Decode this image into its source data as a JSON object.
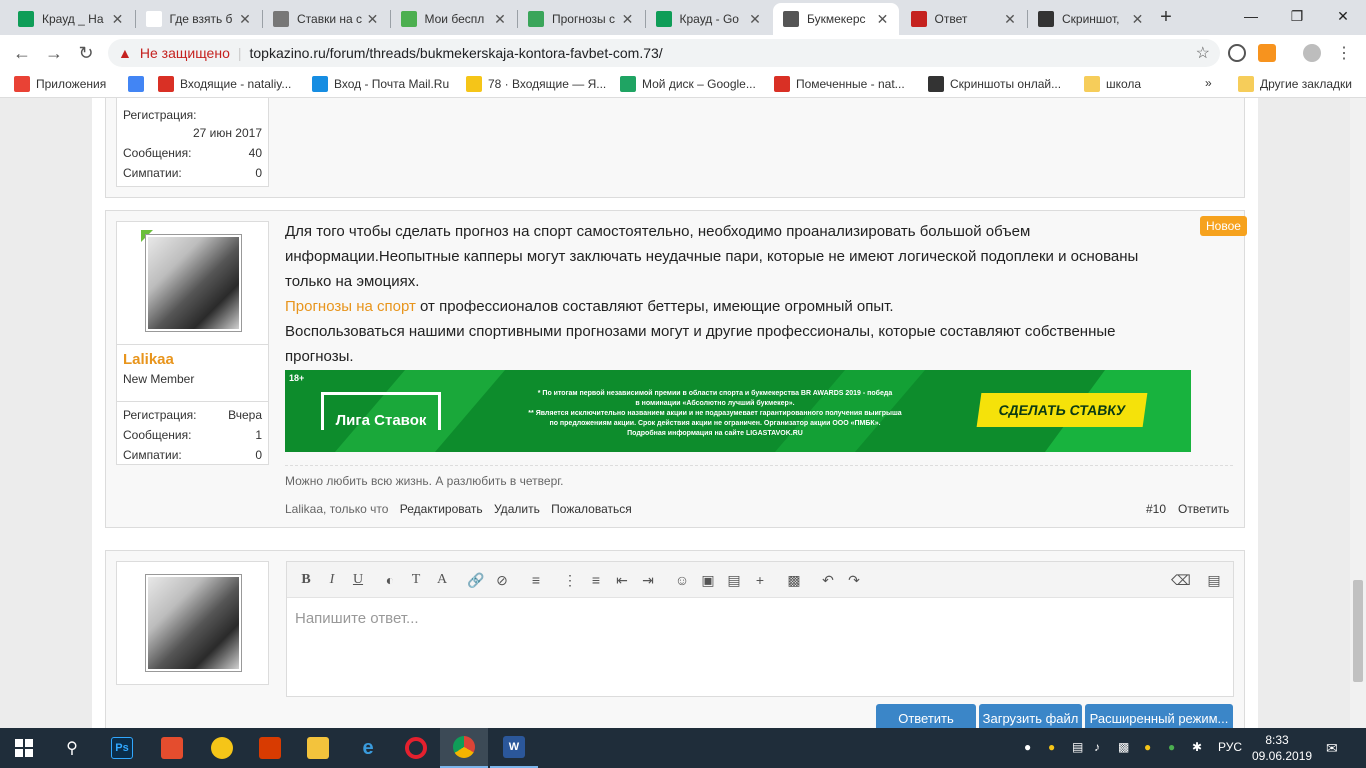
{
  "tabs": [
    {
      "label": "Крауд _ На",
      "icon": "sheets-icon",
      "color": "#0f9d58"
    },
    {
      "label": "Где взять б",
      "icon": "google-icon",
      "color": "#ffffff"
    },
    {
      "label": "Ставки на с",
      "icon": "globe-icon",
      "color": "#777777"
    },
    {
      "label": "Мои беспл",
      "icon": "gem-icon",
      "color": "#4caf50"
    },
    {
      "label": "Прогнозы с",
      "icon": "sp-icon",
      "color": "#3aa55a"
    },
    {
      "label": "Крауд - Go",
      "icon": "sheets-icon",
      "color": "#0f9d58"
    },
    {
      "label": "Букмекерс",
      "icon": "globe-icon",
      "color": "#555555",
      "active": true
    },
    {
      "label": "Ответ",
      "icon": "warning-icon",
      "color": "#c5221f"
    },
    {
      "label": "Скриншот,",
      "icon": "p-icon",
      "color": "#333333"
    }
  ],
  "toolbar": {
    "security": "Не защищено",
    "url": "topkazino.ru/forum/threads/bukmekerskaja-kontora-favbet-com.73/"
  },
  "bookmarks": [
    {
      "label": "Приложения",
      "icon": "apps-icon"
    },
    {
      "label": "",
      "icon": "google-icon"
    },
    {
      "label": "Входящие - nataliy...",
      "icon": "gmail-icon"
    },
    {
      "label": "Вход - Почта Mail.Ru",
      "icon": "mailru-icon"
    },
    {
      "label": "78 · Входящие — Я...",
      "icon": "yandex-mail-icon"
    },
    {
      "label": "Мой диск – Google...",
      "icon": "drive-icon"
    },
    {
      "label": "Помеченные - nat...",
      "icon": "gmail-icon"
    },
    {
      "label": "Скриншоты онлай...",
      "icon": "p-icon"
    },
    {
      "label": "школа",
      "icon": "folder-icon"
    }
  ],
  "bookmarks_more": "»",
  "bookmarks_other": "Другие закладки",
  "prev_user": {
    "reg_label": "Регистрация:",
    "reg_value": "27 июн 2017",
    "msg_label": "Сообщения:",
    "msg_value": "40",
    "likes_label": "Симпатии:",
    "likes_value": "0"
  },
  "post": {
    "badge": "Новое",
    "username": "Lalikaa",
    "role": "New Member",
    "reg_label": "Регистрация:",
    "reg_value": "Вчера",
    "msg_label": "Сообщения:",
    "msg_value": "1",
    "likes_label": "Симпатии:",
    "likes_value": "0",
    "p1": "Для того чтобы сделать прогноз на спорт самостоятельно, необходимо проанализировать большой объем информации.Неопытные капперы могут заключать неудачные пари, которые не имеют логической подоплеки и основаны только на эмоциях.",
    "p2_link": "Прогнозы на спорт",
    "p2_rest": " от профессионалов составляют беттеры, имеющие огромный опыт.",
    "p3": "Воспользоваться нашими спортивными прогнозами могут и другие профессионалы, которые составляют собственные прогнозы.",
    "signature": "Можно любить всю жизнь. А разлюбить в четверг.",
    "meta": "Lalikaa, только что",
    "edit": "Редактировать",
    "delete": "Удалить",
    "report": "Пожаловаться",
    "number": "#10",
    "reply": "Ответить"
  },
  "banner": {
    "age": "18+",
    "brand": "Лига Ставок",
    "line1": "* По итогам первой независимой премии в области спорта и букмекерства BR AWARDS 2019 - победа",
    "line2": "в номинации «Абсолютно лучший букмекер».",
    "line3": "** Является исключительно названием акции и не подразумевает гарантированного получения выигрыша",
    "line4": "по предложениям акции. Срок действия акции не ограничен. Организатор акции ООО «ПМБК».",
    "line5": "Подробная информация на сайте LIGASTAVOK.RU",
    "cta": "СДЕЛАТЬ СТАВКУ"
  },
  "editor": {
    "placeholder": "Напишите ответ...",
    "reply_btn": "Ответить",
    "upload_btn": "Загрузить файл",
    "advanced_btn": "Расширенный режим..."
  },
  "taskbar": {
    "lang": "РУС",
    "time": "8:33",
    "date": "09.06.2019"
  }
}
